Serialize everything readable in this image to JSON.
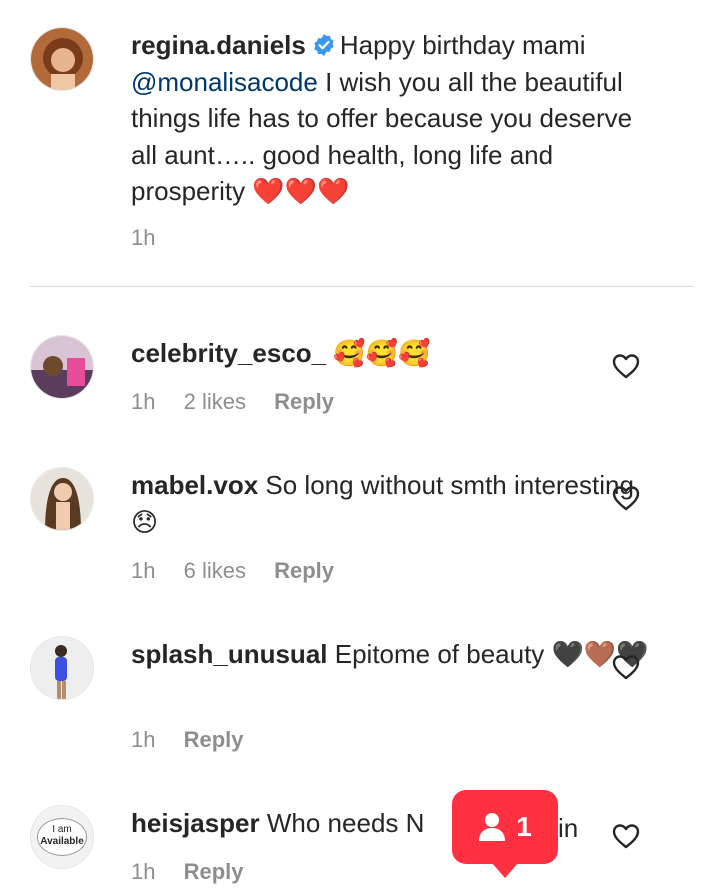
{
  "caption": {
    "username": "regina.daniels",
    "text_before_mention": "Happy birthday mami",
    "mention": "@monalisacode",
    "text_after_mention": "I wish you all the beautiful things life has to offer because you deserve all aunt….. good health, long life and prosperity",
    "emojis": "❤️❤️❤️",
    "time": "1h"
  },
  "comments": [
    {
      "username": "celebrity_esco_",
      "text": "",
      "emojis": "🥰🥰🥰",
      "time": "1h",
      "likes": "2 likes",
      "reply": "Reply"
    },
    {
      "username": "mabel.vox",
      "text": "So long without smth interesting",
      "emojis": "😞",
      "time": "1h",
      "likes": "6 likes",
      "reply": "Reply"
    },
    {
      "username": "splash_unusual",
      "text": "Epitome of beauty",
      "emojis": "🖤🤎🖤",
      "time": "1h",
      "likes": "",
      "reply": "Reply"
    },
    {
      "username": "heisjasper",
      "text": "Who needs N",
      "text_after_toast": "in",
      "emojis": "",
      "time": "1h",
      "likes": "",
      "reply": "Reply",
      "avatar_text_1": "I am",
      "avatar_text_2": "Available"
    }
  ],
  "toast": {
    "count": "1",
    "icon": "person-icon"
  },
  "colors": {
    "accent_red": "#ff3040",
    "mention_blue": "#00376b",
    "meta_gray": "#8e8e8e",
    "verified_blue": "#3897f0"
  }
}
